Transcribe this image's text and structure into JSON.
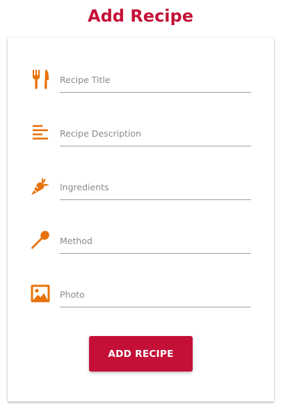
{
  "page": {
    "title": "Add Recipe"
  },
  "theme": {
    "title_color": "#c41037",
    "icon_color": "#e8710a",
    "button_color": "#c41037",
    "button_text_color": "#ffffff",
    "underline_color": "#9e9e9e"
  },
  "form": {
    "fields": [
      {
        "icon": "utensils-icon",
        "placeholder": "Recipe Title",
        "value": ""
      },
      {
        "icon": "align-left-icon",
        "placeholder": "Recipe Description",
        "value": ""
      },
      {
        "icon": "carrot-icon",
        "placeholder": "Ingredients",
        "value": ""
      },
      {
        "icon": "spoon-icon",
        "placeholder": "Method",
        "value": ""
      },
      {
        "icon": "image-icon",
        "placeholder": "Photo",
        "value": ""
      }
    ],
    "submit_label": "ADD RECIPE"
  }
}
